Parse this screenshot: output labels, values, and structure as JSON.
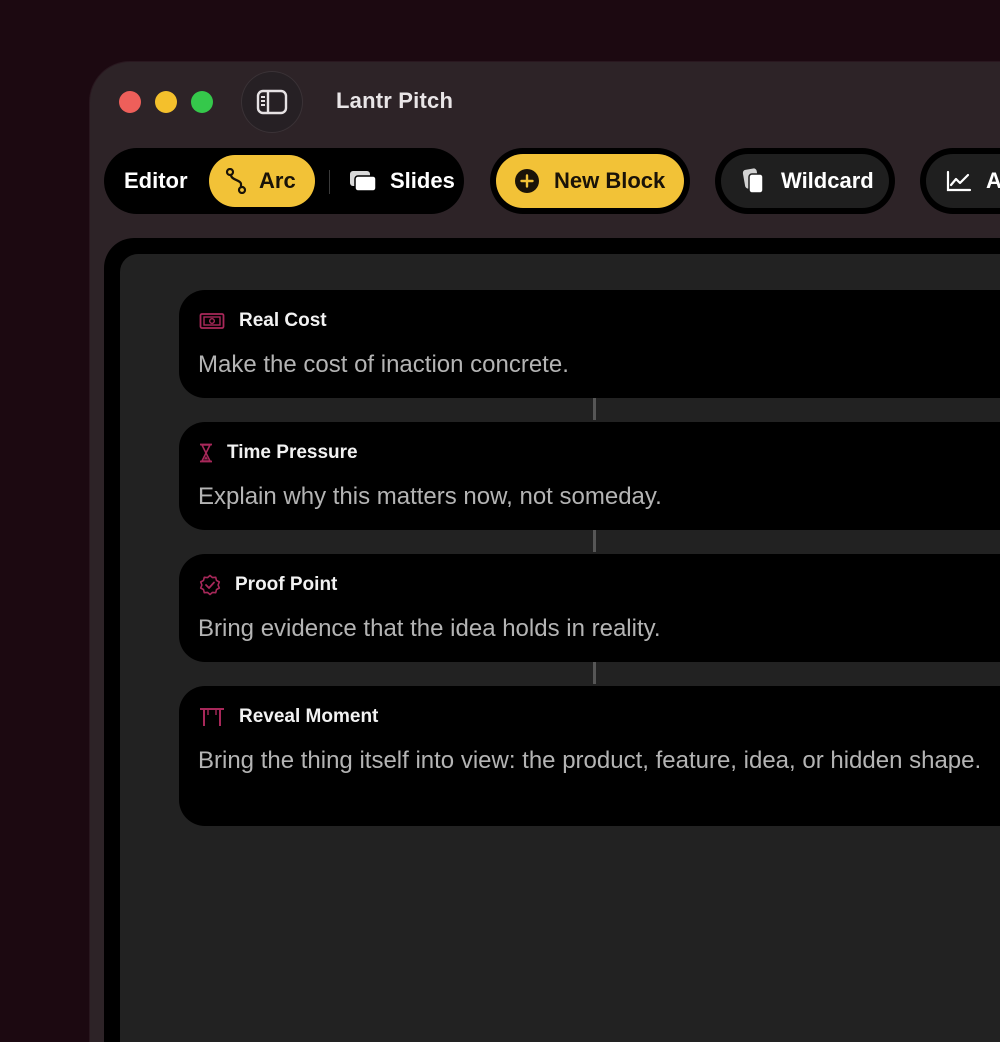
{
  "window": {
    "title": "Lantr Pitch"
  },
  "toolbar": {
    "editor_label": "Editor",
    "modes": [
      {
        "label": "Arc",
        "icon": "route-icon",
        "selected": true
      },
      {
        "label": "Slides",
        "icon": "slides-icon",
        "selected": false
      }
    ],
    "new_block_label": "New Block",
    "wildcard_label": "Wildcard",
    "analytics_label": "A"
  },
  "blocks": [
    {
      "title": "Real Cost",
      "description": "Make the cost of inaction concrete.",
      "icon": "banknote-icon"
    },
    {
      "title": "Time Pressure",
      "description": "Explain why this matters now, not someday.",
      "icon": "hourglass-icon"
    },
    {
      "title": "Proof Point",
      "description": "Bring evidence that the idea holds in reality.",
      "icon": "verified-badge-icon"
    },
    {
      "title": "Reveal Moment",
      "description": "Bring the thing itself into view: the product, feature, idea, or hidden shape.",
      "icon": "curtain-icon"
    }
  ],
  "colors": {
    "accent": "#f2c237",
    "block_icon": "#a8285a",
    "background": "#1c0911"
  }
}
